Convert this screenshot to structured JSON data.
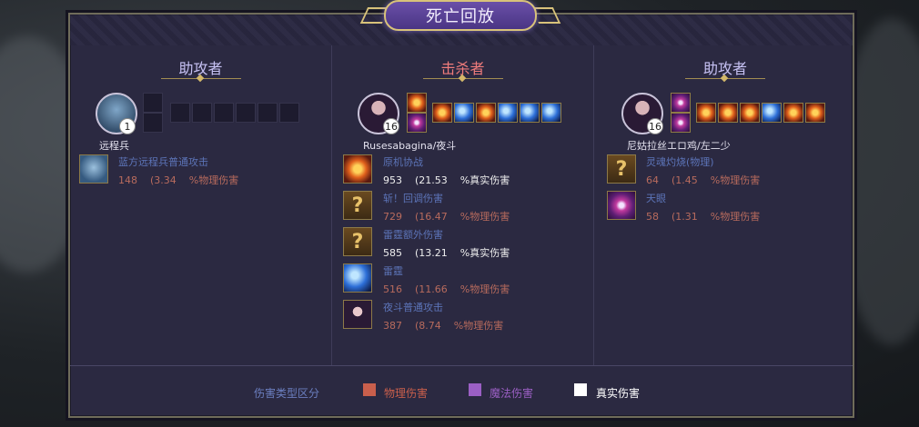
{
  "title": "死亡回放",
  "columns": [
    {
      "heading": "助攻者",
      "name": "远程兵",
      "level": "1",
      "entries": [
        {
          "icon": "minion-attack-icon",
          "name": "蓝方远程兵普通攻击",
          "value": "148",
          "pct": "(3.34",
          "type": "%物理伤害"
        }
      ]
    },
    {
      "heading": "击杀者",
      "name": "Rusesabagina/夜斗",
      "level": "16",
      "entries": [
        {
          "icon": "fire-skill-icon",
          "name": "原机协战",
          "value": "953",
          "pct": "(21.53",
          "type": "%真实伤害"
        },
        {
          "icon": "unknown-skill-icon",
          "name": "斩！回调伤害",
          "value": "729",
          "pct": "(16.47",
          "type": "%物理伤害"
        },
        {
          "icon": "unknown-skill-icon",
          "name": "雷霆额外伤害",
          "value": "585",
          "pct": "(13.21",
          "type": "%真实伤害"
        },
        {
          "icon": "blue-slash-icon",
          "name": "雷霆",
          "value": "516",
          "pct": "(11.66",
          "type": "%物理伤害"
        },
        {
          "icon": "hero-attack-icon",
          "name": "夜斗普通攻击",
          "value": "387",
          "pct": "(8.74",
          "type": "%物理伤害"
        }
      ]
    },
    {
      "heading": "助攻者",
      "name": "尼姑拉丝エロ鸡/左二少",
      "level": "16",
      "entries": [
        {
          "icon": "unknown-skill-icon",
          "name": "灵魂灼烧(物理)",
          "value": "64",
          "pct": "(1.45",
          "type": "%物理伤害"
        },
        {
          "icon": "eye-skill-icon",
          "name": "天眼",
          "value": "58",
          "pct": "(1.31",
          "type": "%物理伤害"
        }
      ]
    }
  ],
  "legend": {
    "label": "伤害类型区分",
    "physical": "物理伤害",
    "magic": "魔法伤害",
    "true": "真实伤害"
  },
  "colors": {
    "physical": "#c95f4c",
    "magic": "#9b5fc4",
    "true": "#ffffff",
    "kill_heading": "#f07c7c",
    "assist_heading": "#c7c2f4"
  }
}
